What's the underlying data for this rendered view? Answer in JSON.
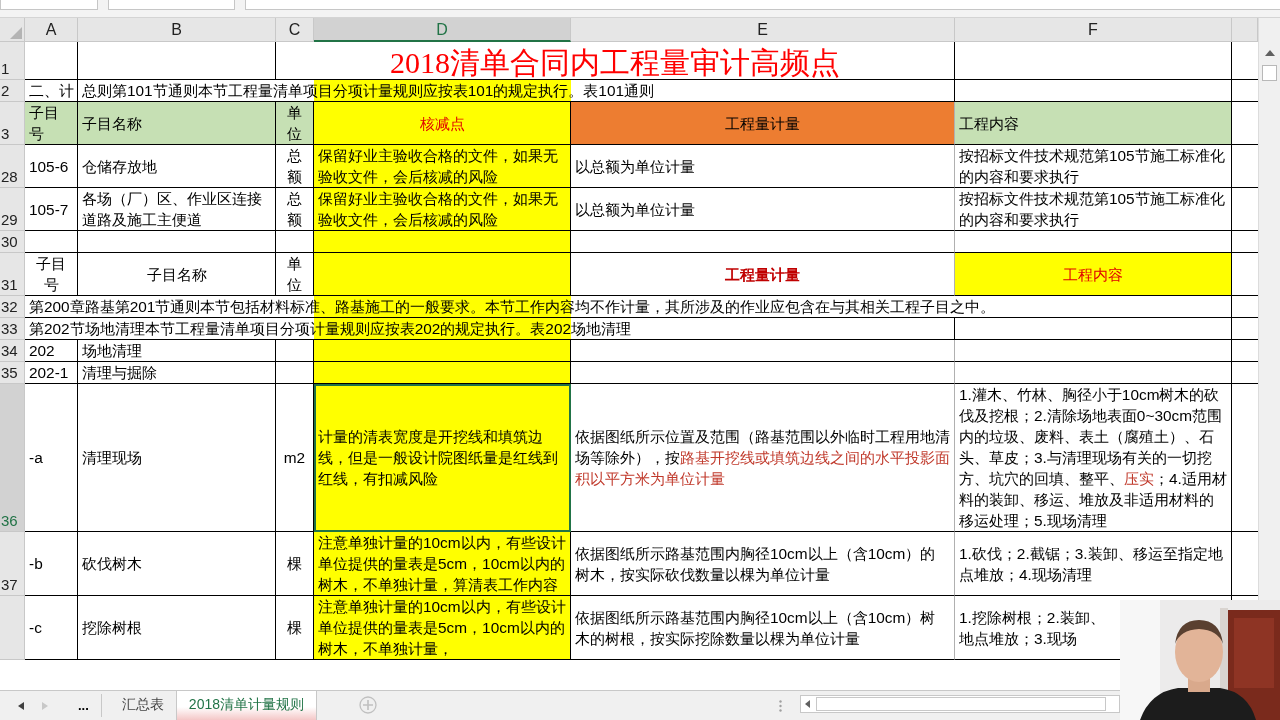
{
  "columns": [
    {
      "label": "A",
      "selected": false
    },
    {
      "label": "B",
      "selected": false
    },
    {
      "label": "C",
      "selected": false
    },
    {
      "label": "D",
      "selected": true
    },
    {
      "label": "E",
      "selected": false
    },
    {
      "label": "F",
      "selected": false
    }
  ],
  "rows": [
    {
      "number": "1",
      "kind": "title",
      "selected": false,
      "text": "2018清单合同内工程量审计高频点"
    },
    {
      "number": "2",
      "kind": "note",
      "selected": false,
      "lead": "二、计",
      "text": "总则第101节通则本节工程量清单项目分项计量规则应按表101的规定执行。表101通则",
      "color": "#ffff00"
    },
    {
      "number": "3",
      "kind": "cells",
      "selected": false,
      "cells": [
        {
          "text": "子目号",
          "color": "#c6e0b4",
          "centered": false,
          "red": false,
          "bold": false
        },
        {
          "text": "子目名称",
          "color": "#c6e0b4",
          "centered": false,
          "red": false,
          "bold": false
        },
        {
          "text": "单位",
          "color": "#c6e0b4",
          "centered": true,
          "red": false,
          "bold": false
        },
        {
          "text": "核减点",
          "color": "#ffff00",
          "centered": true,
          "red": true,
          "bold": false
        },
        {
          "text": "工程量计量",
          "color": "#ed7d31",
          "centered": true,
          "red": false,
          "bold": false
        },
        {
          "text": "工程内容",
          "color": "#c6e0b4",
          "centered": false,
          "red": false,
          "bold": false
        }
      ]
    },
    {
      "number": "28",
      "kind": "cells",
      "selected": false,
      "cells": [
        {
          "text": "105-6",
          "color": "#ffffff",
          "centered": false,
          "red": false,
          "bold": false
        },
        {
          "text": "仓储存放地",
          "color": "#ffffff",
          "centered": false,
          "red": false,
          "bold": false
        },
        {
          "text": "总额",
          "color": "#ffffff",
          "centered": true,
          "red": false,
          "bold": false
        },
        {
          "text": "保留好业主验收合格的文件，如果无验收文件，会后核减的风险",
          "color": "#ffff00",
          "centered": false,
          "red": false,
          "bold": false
        },
        {
          "text": "以总额为单位计量",
          "color": "#ffffff",
          "centered": false,
          "red": false,
          "bold": false
        },
        {
          "text": "按招标文件技术规范第105节施工标准化的内容和要求执行",
          "color": "#ffffff",
          "centered": false,
          "red": false,
          "bold": false
        }
      ]
    },
    {
      "number": "29",
      "kind": "cells",
      "selected": false,
      "cells": [
        {
          "text": "105-7",
          "color": "#ffffff",
          "centered": false,
          "red": false,
          "bold": false
        },
        {
          "text": "各场（厂）区、作业区连接道路及施工主便道",
          "color": "#ffffff",
          "centered": false,
          "red": false,
          "bold": false
        },
        {
          "text": "总额",
          "color": "#ffffff",
          "centered": true,
          "red": false,
          "bold": false
        },
        {
          "text": "保留好业主验收合格的文件，如果无验收文件，会后核减的风险",
          "color": "#ffff00",
          "centered": false,
          "red": false,
          "bold": false
        },
        {
          "text": "以总额为单位计量",
          "color": "#ffffff",
          "centered": false,
          "red": false,
          "bold": false
        },
        {
          "text": "按招标文件技术规范第105节施工标准化的内容和要求执行",
          "color": "#ffffff",
          "centered": false,
          "red": false,
          "bold": false
        }
      ]
    },
    {
      "number": "30",
      "kind": "cells",
      "selected": false,
      "cells": [
        {
          "color": "#ffffff"
        },
        {
          "color": "#ffffff"
        },
        {
          "color": "#ffffff"
        },
        {
          "color": "#ffff00"
        },
        {
          "color": "#ffffff"
        },
        {
          "color": "#ffffff"
        }
      ]
    },
    {
      "number": "31",
      "kind": "cells",
      "selected": false,
      "cells": [
        {
          "text": "子目号",
          "color": "#ffffff",
          "centered": true,
          "red": false,
          "bold": false
        },
        {
          "text": "子目名称",
          "color": "#ffffff",
          "centered": true,
          "red": false,
          "bold": false
        },
        {
          "text": "单位",
          "color": "#ffffff",
          "centered": true,
          "red": false,
          "bold": false
        },
        {
          "color": "#ffff00"
        },
        {
          "text": "工程量计量",
          "color": "#ffffff",
          "centered": true,
          "red": true,
          "bold": true
        },
        {
          "text": "工程内容",
          "color": "#ffff00",
          "centered": true,
          "red": true,
          "bold": false
        }
      ]
    },
    {
      "number": "32",
      "kind": "note",
      "selected": false,
      "text": "第200章路基第201节通则本节包括材料标准、路基施工的一般要求。本节工作内容均不作计量，其所涉及的作业应包含在与其相关工程子目之中。",
      "color": "#ffff00"
    },
    {
      "number": "33",
      "kind": "note",
      "selected": false,
      "text": "第202节场地清理本节工程量清单项目分项计量规则应按表202的规定执行。表202场地清理",
      "color": "#ffff00"
    },
    {
      "number": "34",
      "kind": "cells",
      "selected": false,
      "cells": [
        {
          "text": "202",
          "color": "#ffffff",
          "centered": false,
          "red": false,
          "bold": false
        },
        {
          "text": "场地清理",
          "color": "#ffffff",
          "centered": false,
          "red": false,
          "bold": false
        },
        {
          "color": "#ffffff"
        },
        {
          "color": "#ffff00"
        },
        {
          "color": "#ffffff"
        },
        {
          "color": "#ffffff"
        }
      ]
    },
    {
      "number": "35",
      "kind": "cells",
      "selected": false,
      "cells": [
        {
          "text": "202-1",
          "color": "#ffffff",
          "centered": false,
          "red": false,
          "bold": false
        },
        {
          "text": "清理与掘除",
          "color": "#ffffff",
          "centered": false,
          "red": false,
          "bold": false
        },
        {
          "color": "#ffffff"
        },
        {
          "color": "#ffff00"
        },
        {
          "color": "#ffffff"
        },
        {
          "color": "#ffffff"
        }
      ]
    },
    {
      "number": "36",
      "kind": "cells",
      "selected": true,
      "cells": [
        {
          "text": "-a",
          "color": "#ffffff",
          "centered": false,
          "red": false,
          "bold": false
        },
        {
          "text": "清理现场",
          "color": "#ffffff",
          "centered": false,
          "red": false,
          "bold": false
        },
        {
          "text": "m2",
          "color": "#ffffff",
          "centered": true,
          "red": false,
          "bold": false
        },
        {
          "text": "计量的清表宽度是开挖线和填筑边线，但是一般设计院图纸量是红线到红线，有扣减风险",
          "color": "#ffff00",
          "centered": false,
          "red": false,
          "bold": false
        },
        {
          "runs": [
            {
              "text": "依据图纸所示位置及范围（路基范围以外临时工程用地清场等除外），按",
              "red": false
            },
            {
              "text": "路基开挖线或填筑边线之间的水平投影面积以平方米为单位计量",
              "red": true
            }
          ],
          "color": "#ffffff",
          "centered": false
        },
        {
          "runs": [
            {
              "text": "1.灌木、竹林、胸径小于10cm树木的砍伐及挖根；2.清除场地表面0~30cm范围内的垃圾、废料、表土（腐殖土）、石头、草皮；3.与清理现场有关的一切挖方、坑穴的回填、整平、",
              "red": false
            },
            {
              "text": "压实",
              "red": true
            },
            {
              "text": "；4.适用材料的装卸、移运、堆放及非适用材料的移运处理；5.现场清理",
              "red": false
            }
          ],
          "color": "#ffffff",
          "centered": false
        }
      ]
    },
    {
      "number": "37",
      "kind": "cells",
      "selected": false,
      "cells": [
        {
          "text": "-b",
          "color": "#ffffff",
          "centered": false,
          "red": false,
          "bold": false
        },
        {
          "text": "砍伐树木",
          "color": "#ffffff",
          "centered": false,
          "red": false,
          "bold": false
        },
        {
          "text": "棵",
          "color": "#ffffff",
          "centered": true,
          "red": false,
          "bold": false
        },
        {
          "text": "注意单独计量的10cm以内，有些设计单位提供的量表是5cm，10cm以内的树木，不单独计量，算清表工作内容",
          "color": "#ffff00",
          "centered": false,
          "red": false,
          "bold": false
        },
        {
          "text": "依据图纸所示路基范围内胸径10cm以上（含10cm）的树木，按实际砍伐数量以棵为单位计量",
          "color": "#ffffff",
          "centered": false,
          "red": false,
          "bold": false
        },
        {
          "text": "1.砍伐；2.截锯；3.装卸、移运至指定地点堆放；4.现场清理",
          "color": "#ffffff",
          "centered": false,
          "red": false,
          "bold": false
        }
      ]
    },
    {
      "kind": "cells",
      "selected": false,
      "cells": [
        {
          "text": "-c",
          "color": "#ffffff",
          "centered": false,
          "red": false,
          "bold": false
        },
        {
          "text": "挖除树根",
          "color": "#ffffff",
          "centered": false,
          "red": false,
          "bold": false
        },
        {
          "text": "棵",
          "color": "#ffffff",
          "centered": true,
          "red": false,
          "bold": false
        },
        {
          "text": "注意单独计量的10cm以内，有些设计单位提供的量表是5cm，10cm以内的树木，不单独计量，",
          "color": "#ffff00",
          "centered": false,
          "red": false,
          "bold": false
        },
        {
          "text": "依据图纸所示路基范围内胸径10cm以上（含10cm）树木的树根，按实际挖除数量以棵为单位计量",
          "color": "#ffffff",
          "centered": false,
          "red": false,
          "bold": false
        },
        {
          "lines": [
            "1.挖除树根；2.装卸、",
            "地点堆放；3.现场"
          ],
          "color": "#ffffff",
          "centered": false,
          "red": false,
          "bold": false
        }
      ]
    }
  ],
  "sheet_tabs": {
    "more": "...",
    "tabs": [
      {
        "label": "汇总表",
        "selected": false
      },
      {
        "label": "2018清单计量规则",
        "selected": true
      }
    ]
  }
}
